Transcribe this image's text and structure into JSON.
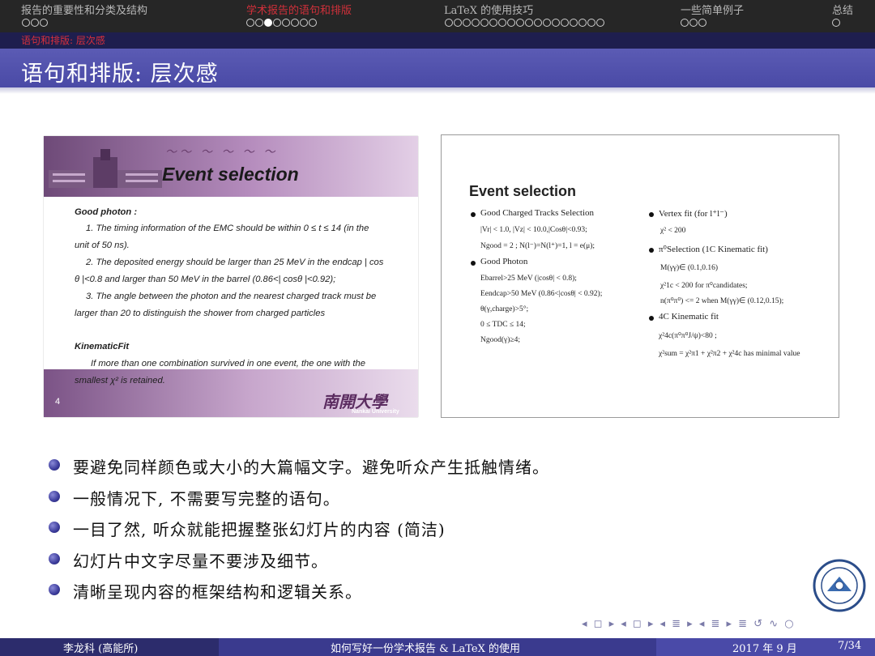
{
  "nav": {
    "sections": [
      {
        "label": "报告的重要性和分类及结构",
        "dots": 3,
        "filled": -1,
        "active": false
      },
      {
        "label": "学术报告的语句和排版",
        "dots": 8,
        "filled": 2,
        "active": true
      },
      {
        "label": "LaTeX 的使用技巧",
        "dots": 18,
        "filled": -1,
        "active": false
      },
      {
        "label": "一些简单例子",
        "dots": 3,
        "filled": -1,
        "active": false
      },
      {
        "label": "总结",
        "dots": 1,
        "filled": -1,
        "active": false
      }
    ]
  },
  "subsection": "语句和排版: 层次感",
  "title": "语句和排版: 层次感",
  "left_image": {
    "header": "Event selection",
    "good_photon": "Good photon :",
    "line1": "1. The timing information of the EMC should be within 0 ≤ t ≤ 14 (in the",
    "line2": "unit of 50 ns).",
    "line3": "2. The deposited energy should be larger than 25 MeV in the endcap | cos",
    "line4": "θ |<0.8 and larger than 50 MeV in the barrel (0.86<| cosθ |<0.92);",
    "line5": "3. The angle between the photon and the nearest charged track must be",
    "line6": "larger than 20 to distinguish the shower from charged particles",
    "kin": "KinematicFit",
    "line7": "If more than one combination survived in one event, the one with the",
    "line8": "smallest χ² is retained.",
    "page": "4",
    "univ": "Nankai University"
  },
  "right_image": {
    "heading": "Event selection",
    "l_b1": "Good Charged Tracks Selection",
    "l_b1_a": "|Vr| < 1.0, |Vz| < 10.0,|Cosθ|<0.93;",
    "l_b1_b": "Ngood = 2 ; N(l⁻)=N(l⁺)=1, l = e(μ);",
    "l_b2": "Good Photon",
    "l_b2_a": "Ebarrel>25 MeV (|cosθ| < 0.8);",
    "l_b2_b": "Eendcap>50 MeV (0.86<|cosθ| < 0.92);",
    "l_b2_c": "θ(γ,charge)>5°;",
    "l_b2_d": "0 ≤ TDC ≤ 14;",
    "l_b2_e": "Ngood(γ)≥4;",
    "r_b1": "Vertex fit (for l⁺l⁻)",
    "r_b1_a": "χ² < 200",
    "r_b2": "π⁰Selection (1C Kinematic fit)",
    "r_b2_a": "M(γγ)∈ (0.1,0.16)",
    "r_b2_b": "χ²1c < 200 for π⁰candidates;",
    "r_b2_c": "n(π⁰π⁰) <= 2 when M(γγ)∈ (0.12,0.15);",
    "r_b3": "4C Kinematic fit",
    "r_b3_a": "χ²4c(π⁰π⁰J/ψ)<80 ;",
    "r_b3_b": "χ²sum = χ²π1 + χ²π2 + χ²4c has minimal value"
  },
  "bullets": [
    "要避免同样颜色或大小的大篇幅文字。避免听众产生抵触情绪。",
    "一般情况下, 不需要写完整的语句。",
    "一目了然, 听众就能把握整张幻灯片的内容 (简洁)",
    "幻灯片中文字尽量不要涉及细节。",
    "清晰呈现内容的框架结构和逻辑关系。"
  ],
  "beamer_nav": "◂ ◻ ▸ ◂ ◻ ▸ ◂ ≣ ▸ ◂ ≣ ▸ ≣ ↺ ∿ ○",
  "footer": {
    "author": "李龙科 (高能所)",
    "title": "如何写好一份学术报告 & LaTeX 的使用",
    "date": "2017 年 9 月",
    "page": "7/34"
  },
  "colors": {
    "nav_bg": "#262626",
    "active_section": "#d0303a",
    "title_bar": "#4a4aa6",
    "footer_left": "#2c2c6c",
    "footer_mid": "#3a3a8e",
    "footer_right": "#4a4aa8"
  }
}
